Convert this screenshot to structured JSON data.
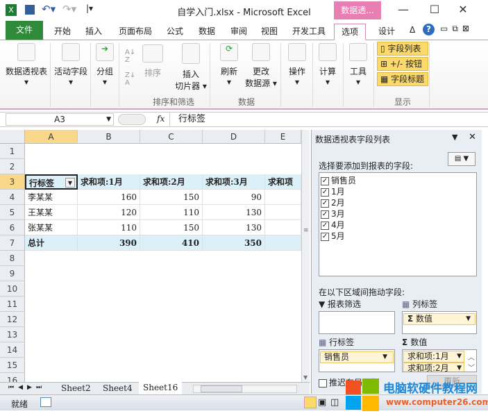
{
  "title": "自学入门.xlsx - Microsoft Excel",
  "context_tab": "数据透...",
  "tabs": [
    "文件",
    "开始",
    "插入",
    "页面布局",
    "公式",
    "数据",
    "审阅",
    "视图",
    "开发工具",
    "选项",
    "设计"
  ],
  "ribbon": {
    "pivot": "数据透视表",
    "active_field": "活动字段",
    "group": "分组",
    "sort": "排序",
    "slicer1": "插入",
    "slicer2": "切片器",
    "refresh": "刷新",
    "change1": "更改",
    "change2": "数据源",
    "actions": "操作",
    "calc": "计算",
    "tools": "工具",
    "field_list": "字段列表",
    "buttons": "+/- 按钮",
    "headers": "字段标题",
    "grp_sort": "排序和筛选",
    "grp_data": "数据",
    "grp_show": "显示"
  },
  "name_box": "A3",
  "fx": "fx",
  "formula": "行标签",
  "columns": [
    "A",
    "B",
    "C",
    "D",
    "E"
  ],
  "rows": [
    "1",
    "2",
    "3",
    "4",
    "5",
    "6",
    "7",
    "8",
    "9",
    "10",
    "11",
    "12",
    "13",
    "14",
    "15",
    "16"
  ],
  "table": {
    "header": [
      "行标签",
      "求和项:1月",
      "求和项:2月",
      "求和项:3月",
      "求和项"
    ],
    "body": [
      [
        "李某某",
        "160",
        "150",
        "90"
      ],
      [
        "王某某",
        "120",
        "110",
        "130"
      ],
      [
        "张某某",
        "110",
        "150",
        "130"
      ]
    ],
    "total": [
      "总计",
      "390",
      "410",
      "350"
    ]
  },
  "pane": {
    "title": "数据透视表字段列表",
    "choose": "选择要添加到报表的字段:",
    "fields": [
      "销售员",
      "1月",
      "2月",
      "3月",
      "4月",
      "5月"
    ],
    "drag": "在以下区域间拖动字段:",
    "filter": "报表筛选",
    "col_label": "列标签",
    "row_label": "行标签",
    "values": "数值",
    "col_item": "数值",
    "row_item": "销售员",
    "value_items": [
      "求和项:1月",
      "求和项:2月"
    ],
    "defer": "推迟布局更新",
    "update": "更新"
  },
  "sheets": [
    "Sheet2",
    "Sheet4",
    "Sheet16"
  ],
  "status": "就绪",
  "watermark": {
    "text": "电脑软硬件教程网",
    "url": "www.computer26.com"
  }
}
